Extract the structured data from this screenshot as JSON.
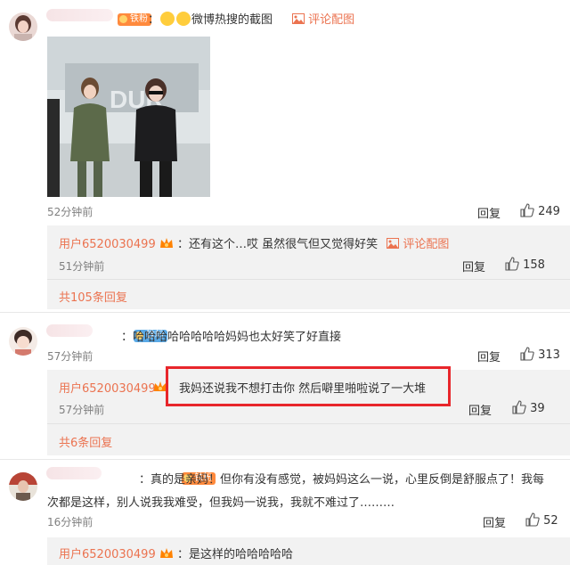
{
  "comments": [
    {
      "text": "：😂😂微博热搜的截图",
      "fan_badge": "铁粉",
      "pic_link": "评论配图",
      "time": "52分钟前",
      "reply_label": "回复",
      "likes": "249",
      "replies": [
        {
          "user": "用户6520030499",
          "text": "：还有这个…哎 虽然很气但又觉得好笑",
          "pic_link": "评论配图",
          "time": "51分钟前",
          "reply_label": "回复",
          "likes": "158"
        }
      ],
      "more_replies": "共105条回复"
    },
    {
      "text": "：哈哈哈哈哈哈哈哈妈妈也太好笑了好直接",
      "fan_badge": "铁粉",
      "time": "57分钟前",
      "reply_label": "回复",
      "likes": "313",
      "replies": [
        {
          "user": "用户6520030499",
          "text": "我妈还说我不想打击你 然后噼里啪啦说了一大堆",
          "time": "57分钟前",
          "reply_label": "回复",
          "likes": "39"
        }
      ],
      "more_replies": "共6条回复"
    },
    {
      "text": "：真的是亲妈！但你有没有感觉，被妈妈这么一说，心里反倒是舒服点了！我每",
      "text_line2": "次都是这样，别人说我我难受，但我妈一说我，我就不难过了………",
      "fan_badge": "铁粉",
      "time": "16分钟前",
      "reply_label": "回复",
      "likes": "52",
      "replies": [
        {
          "user": "用户6520030499",
          "text": "：是这样的哈哈哈哈哈"
        }
      ]
    }
  ],
  "colors": {
    "link_orange": "#eb7350",
    "highlight_red": "#e8262b",
    "subbox_bg": "#f2f2f2"
  }
}
